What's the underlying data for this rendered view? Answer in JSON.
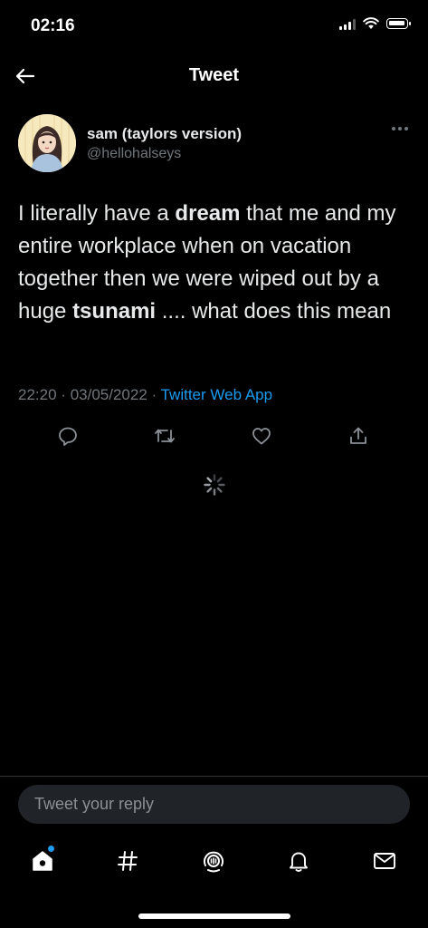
{
  "status_bar": {
    "time": "02:16"
  },
  "header": {
    "title": "Tweet"
  },
  "tweet": {
    "author_name": "sam (taylors version)",
    "author_handle": "@hellohalseys",
    "text_parts": [
      "I literally have a ",
      "dream",
      " that me and my entire workplace when on vacation together then we were wiped out by a huge ",
      "tsunami",
      " .... what does this mean"
    ],
    "time": "22:20",
    "date": "03/05/2022",
    "source": "Twitter Web App",
    "separator": "·"
  },
  "actions": [
    "reply-icon",
    "retweet-icon",
    "like-icon",
    "share-icon"
  ],
  "reply": {
    "placeholder": "Tweet your reply"
  },
  "tab_bar": [
    "home-icon",
    "explore-icon",
    "spaces-icon",
    "notifications-icon",
    "messages-icon"
  ],
  "colors": {
    "background": "#000000",
    "accent": "#1d9bf0",
    "muted": "#71767b",
    "text": "#e7e9ea"
  }
}
